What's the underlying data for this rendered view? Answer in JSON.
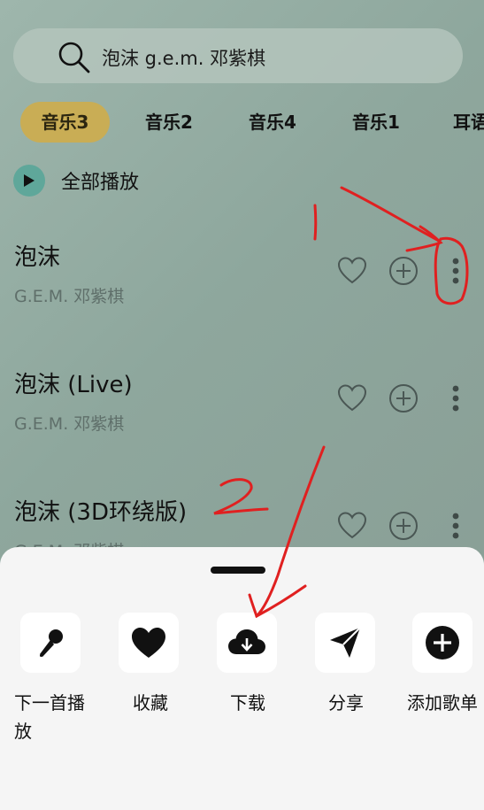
{
  "search": {
    "query": "泡沫 g.e.m. 邓紫棋"
  },
  "tabs": [
    {
      "label": "音乐3",
      "active": true
    },
    {
      "label": "音乐2"
    },
    {
      "label": "音乐4"
    },
    {
      "label": "音乐1"
    },
    {
      "label": "耳语"
    }
  ],
  "play_all": {
    "label": "全部播放"
  },
  "songs": [
    {
      "title": "泡沫",
      "artist": "G.E.M. 邓紫棋"
    },
    {
      "title": "泡沫 (Live)",
      "artist": "G.E.M. 邓紫棋"
    },
    {
      "title": "泡沫 (3D环绕版)",
      "artist": "G.E.M. 邓紫棋"
    }
  ],
  "sheet": {
    "actions": [
      {
        "label": "下一首播放",
        "icon": "microphone-icon"
      },
      {
        "label": "收藏",
        "icon": "heart-icon"
      },
      {
        "label": "下载",
        "icon": "cloud-download-icon"
      },
      {
        "label": "分享",
        "icon": "paper-plane-icon"
      },
      {
        "label": "添加歌单",
        "icon": "plus-circle-icon"
      }
    ]
  },
  "annotations": {
    "mark1": "1",
    "mark2": "2"
  },
  "colors": {
    "accent_tab": "#c9ad55",
    "play_button": "#5fa79a",
    "annotation": "#e02020"
  }
}
